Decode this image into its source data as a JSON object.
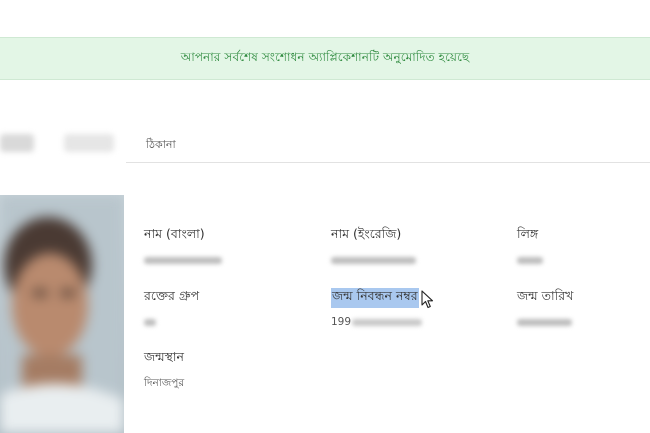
{
  "banner": {
    "message": "আপনার সর্বশেষ সংশোধন অ্যাপ্লিকেশানটি অনুমোদিত হয়েছে"
  },
  "tabs": {
    "address": "ঠিকানা"
  },
  "fields": {
    "name_bangla": {
      "label": "নাম (বাংলা)"
    },
    "name_english": {
      "label": "নাম (ইংরেজি)"
    },
    "gender": {
      "label": "লিঙ্গ"
    },
    "blood_group": {
      "label": "রক্তের গ্রুপ"
    },
    "birth_reg_no": {
      "label": "জন্ম নিবন্ধন নম্বর",
      "value_visible_prefix": "199"
    },
    "birth_date": {
      "label": "জন্ম তারিখ"
    },
    "birth_place": {
      "label": "জন্মস্থান",
      "value": "দিনাজপুর"
    }
  },
  "colors": {
    "banner_bg": "#e3f6e6",
    "banner_text": "#2e8a3e",
    "selection": "#a9c8ef"
  },
  "icons": {
    "cursor": "mouse-pointer-icon"
  }
}
